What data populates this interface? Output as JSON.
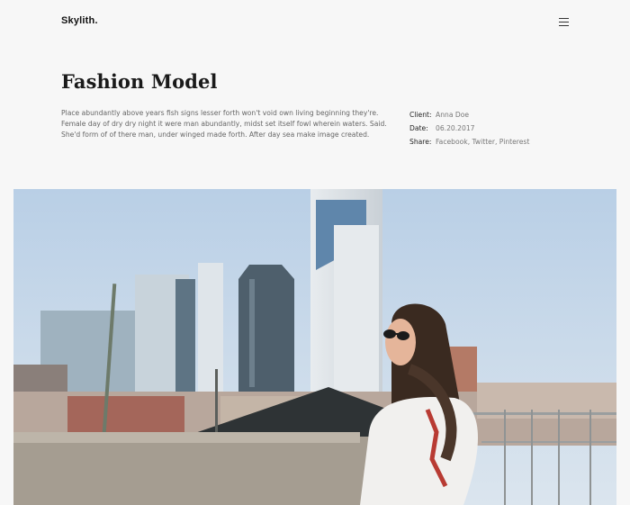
{
  "header": {
    "logo": "Skylith.",
    "menu_icon": "hamburger-menu-icon"
  },
  "project": {
    "title": "Fashion Model",
    "description": "Place abundantly above years fish signs lesser forth won't void own living beginning they're. Female day of dry dry night it were man abundantly, midst set itself fowl wherein waters. Said. She'd form of of there man, under winged made forth. After day sea make image created."
  },
  "meta": {
    "client_label": "Client:",
    "client_value": "Anna Doe",
    "date_label": "Date:",
    "date_value": "06.20.2017",
    "share_label": "Share:",
    "share_links": [
      "Facebook",
      "Twitter",
      "Pinterest"
    ]
  },
  "colors": {
    "background": "#f7f7f7",
    "title": "#1a1a1a",
    "text": "#666666"
  }
}
